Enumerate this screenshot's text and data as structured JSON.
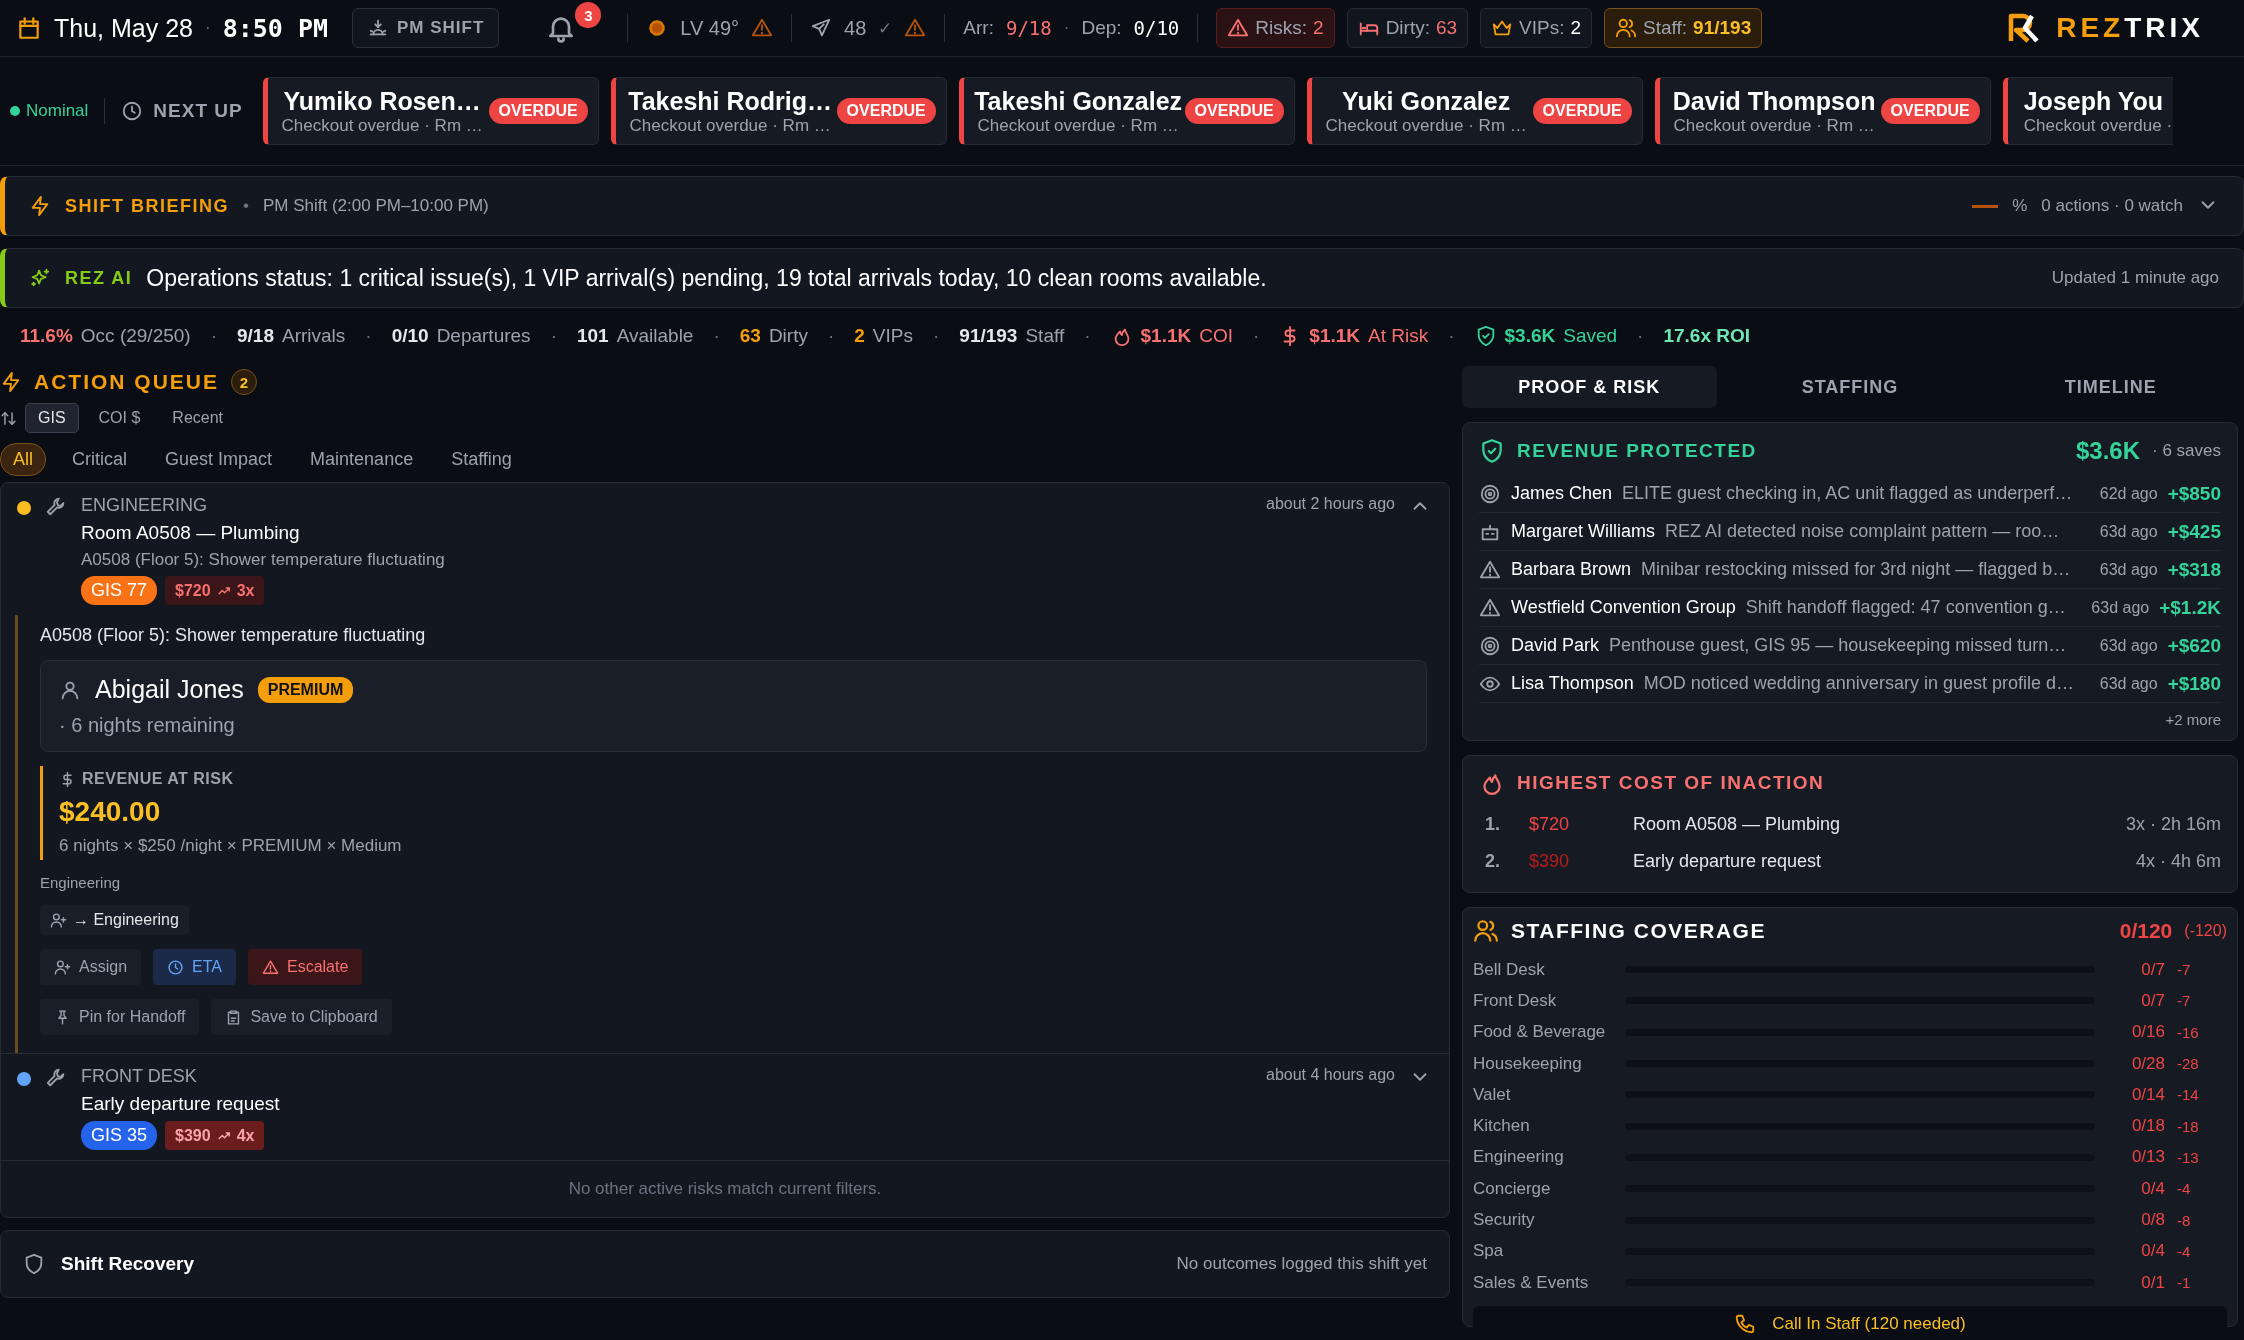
{
  "top_bar": {
    "date": "Thu, May 28",
    "date_sep": "·",
    "time": "8:50 PM",
    "shift_button": "PM SHIFT",
    "notifications": "3",
    "weather": {
      "text": "LV 49°"
    },
    "flights": {
      "count": "48",
      "check": "✓"
    },
    "arrivals": {
      "label": "Arr:",
      "value": "9/18"
    },
    "flow_sep": "·",
    "departures": {
      "label": "Dep:",
      "value": "0/10"
    },
    "chips": [
      {
        "kind": "risk",
        "label": "Risks:",
        "value": "2"
      },
      {
        "kind": "dirty",
        "label": "Dirty:",
        "value": "63"
      },
      {
        "kind": "vip",
        "label": "VIPs:",
        "value": "2"
      },
      {
        "kind": "staff",
        "label": "Staff:",
        "value": "91/193"
      }
    ],
    "logo": {
      "first": "REZ",
      "second": "TRIX"
    }
  },
  "next_up": {
    "status": "Nominal",
    "label": "NEXT UP",
    "cards": [
      {
        "name": "Yumiko Rosen…",
        "detail": "Checkout overdue · Rm …",
        "badge": "OVERDUE"
      },
      {
        "name": "Takeshi Rodrig…",
        "detail": "Checkout overdue · Rm …",
        "badge": "OVERDUE"
      },
      {
        "name": "Takeshi Gonzalez",
        "detail": "Checkout overdue · Rm …",
        "badge": "OVERDUE"
      },
      {
        "name": "Yuki Gonzalez",
        "detail": "Checkout overdue · Rm …",
        "badge": "OVERDUE"
      },
      {
        "name": "David Thompson",
        "detail": "Checkout overdue · Rm …",
        "badge": "OVERDUE"
      },
      {
        "name": "Joseph You",
        "detail": "Checkout overdue ·"
      }
    ]
  },
  "briefing": {
    "title": "SHIFT BRIEFING",
    "sep": "•",
    "shift": "PM Shift (2:00 PM–10:00 PM)",
    "percent": "%",
    "summary": "0 actions · 0 watch",
    "expanded": false
  },
  "rez_ai": {
    "label": "REZ AI",
    "message": "Operations status: 1 critical issue(s), 1 VIP arrival(s) pending, 19 total arrivals today, 10 clean rooms available.",
    "updated": "Updated 1 minute ago"
  },
  "stats": [
    {
      "kind": "occ",
      "value": "11.6%",
      "label": "Occ (29/250)"
    },
    {
      "kind": "plain",
      "sep": "·",
      "value": "9/18",
      "label": "Arrivals"
    },
    {
      "kind": "plain",
      "sep": "·",
      "value": "0/10",
      "label": "Departures"
    },
    {
      "kind": "plain",
      "sep": "·",
      "value": "101",
      "label": "Available"
    },
    {
      "kind": "warn",
      "sep": "·",
      "value": "63",
      "label": "Dirty"
    },
    {
      "kind": "warn",
      "sep": "·",
      "value": "2",
      "label": "VIPs"
    },
    {
      "kind": "plain",
      "sep": "·",
      "value": "91/193",
      "label": "Staff"
    },
    {
      "kind": "coi",
      "sep": "·",
      "value": "$1.1K",
      "label": "COI"
    },
    {
      "kind": "risk",
      "sep": "·",
      "value": "$1.1K",
      "label": "At Risk"
    },
    {
      "kind": "saved",
      "sep": "·",
      "value": "$3.6K",
      "label": "Saved"
    },
    {
      "kind": "roi",
      "sep": "·",
      "value": "17.6x ROI"
    }
  ],
  "action_queue": {
    "title": "ACTION QUEUE",
    "count": "2",
    "sort_options": [
      {
        "label": "GIS",
        "selected": true
      },
      {
        "label": "COI $",
        "selected": false
      },
      {
        "label": "Recent",
        "selected": false
      }
    ],
    "filters": [
      {
        "label": "All",
        "selected": true
      },
      {
        "label": "Critical",
        "selected": false
      },
      {
        "label": "Guest Impact",
        "selected": false
      },
      {
        "label": "Maintenance",
        "selected": false
      },
      {
        "label": "Staffing",
        "selected": false
      }
    ],
    "items": [
      {
        "kind": "high",
        "color": "#fbbf24",
        "department": "ENGINEERING",
        "title": "Room A0508 — Plumbing",
        "description": "A0508 (Floor 5): Shower temperature fluctuating",
        "gis": "GIS 77",
        "coi": "$720",
        "multiplier": "3x",
        "time": "about 2 hours ago",
        "expanded": true,
        "detail": {
          "text": "A0508 (Floor 5): Shower temperature fluctuating",
          "guest": "Abigail Jones",
          "tier": "PREMIUM",
          "stay": "· 6 nights remaining",
          "revenue_label": "REVENUE AT RISK",
          "revenue": "$240.00",
          "formula": "6 nights × $250 /night × PREMIUM × Medium",
          "department": "Engineering",
          "route": "→ Engineering",
          "actions": [
            {
              "kind": "assign",
              "label": "Assign"
            },
            {
              "kind": "eta",
              "label": "ETA"
            },
            {
              "kind": "escalate",
              "label": "Escalate"
            },
            {
              "kind": "pin",
              "label": "Pin for Handoff"
            },
            {
              "kind": "clipboard",
              "label": "Save to Clipboard"
            }
          ]
        }
      },
      {
        "kind": "medium",
        "color": "#60a5fa",
        "department": "FRONT DESK",
        "title": "Early departure request",
        "gis": "GIS 35",
        "coi": "$390",
        "multiplier": "4x",
        "time": "about 4 hours ago",
        "expanded": false
      }
    ],
    "empty_note": "No other active risks match current filters."
  },
  "shift_recovery": {
    "title": "Shift Recovery",
    "note": "No outcomes logged this shift yet"
  },
  "tabs": [
    {
      "label": "PROOF & RISK",
      "selected": true
    },
    {
      "label": "STAFFING",
      "selected": false
    },
    {
      "label": "TIMELINE",
      "selected": false
    }
  ],
  "revenue_protected": {
    "title": "REVENUE PROTECTED",
    "total": "$3.6K",
    "saves": "· 6 saves",
    "rows": [
      {
        "kind": "target",
        "name": "James Chen",
        "description": "ELITE guest checking in, AC unit flagged as underperf…",
        "ago": "62d ago",
        "amount": "+$850"
      },
      {
        "kind": "robot",
        "name": "Margaret Williams",
        "description": "REZ AI detected noise complaint pattern — roo…",
        "ago": "63d ago",
        "amount": "+$425"
      },
      {
        "kind": "alert",
        "name": "Barbara Brown",
        "description": "Minibar restocking missed for 3rd night — flagged b…",
        "ago": "63d ago",
        "amount": "+$318"
      },
      {
        "kind": "alert",
        "name": "Westfield Convention Group",
        "description": "Shift handoff flagged: 47 convention g…",
        "ago": "63d ago",
        "amount": "+$1.2K"
      },
      {
        "kind": "target",
        "name": "David Park",
        "description": "Penthouse guest, GIS 95 — housekeeping missed turn…",
        "ago": "63d ago",
        "amount": "+$620"
      },
      {
        "kind": "watch",
        "name": "Lisa Thompson",
        "description": "MOD noticed wedding anniversary in guest profile d…",
        "ago": "63d ago",
        "amount": "+$180"
      }
    ],
    "more": "+2 more"
  },
  "cost_of_inaction": {
    "title": "HIGHEST COST OF INACTION",
    "rows": [
      {
        "rank": "1.",
        "amount": "$720",
        "title": "Room A0508 — Plumbing",
        "meta": "3x · 2h 16m",
        "kind": "top"
      },
      {
        "rank": "2.",
        "amount": "$390",
        "title": "Early departure request",
        "meta": "4x · 4h 6m",
        "kind": "lower"
      }
    ]
  },
  "staffing_coverage": {
    "title": "STAFFING COVERAGE",
    "total": "0/120",
    "gap": "(-120)",
    "rows": [
      {
        "name": "Bell Desk",
        "level": 0,
        "count": "0/7",
        "gap": "-7"
      },
      {
        "name": "Front Desk",
        "level": 0,
        "count": "0/7",
        "gap": "-7"
      },
      {
        "name": "Food & Beverage",
        "level": 0,
        "count": "0/16",
        "gap": "-16"
      },
      {
        "name": "Housekeeping",
        "level": 0,
        "count": "0/28",
        "gap": "-28"
      },
      {
        "name": "Valet",
        "level": 0,
        "count": "0/14",
        "gap": "-14"
      },
      {
        "name": "Kitchen",
        "level": 0,
        "count": "0/18",
        "gap": "-18"
      },
      {
        "name": "Engineering",
        "level": 0,
        "count": "0/13",
        "gap": "-13"
      },
      {
        "name": "Concierge",
        "level": 0,
        "count": "0/4",
        "gap": "-4"
      },
      {
        "name": "Security",
        "level": 0,
        "count": "0/8",
        "gap": "-8"
      },
      {
        "name": "Spa",
        "level": 0,
        "count": "0/4",
        "gap": "-4"
      },
      {
        "name": "Sales & Events",
        "level": 0,
        "count": "0/1",
        "gap": "-1"
      }
    ],
    "call_button": "Call In Staff (120 needed)"
  }
}
